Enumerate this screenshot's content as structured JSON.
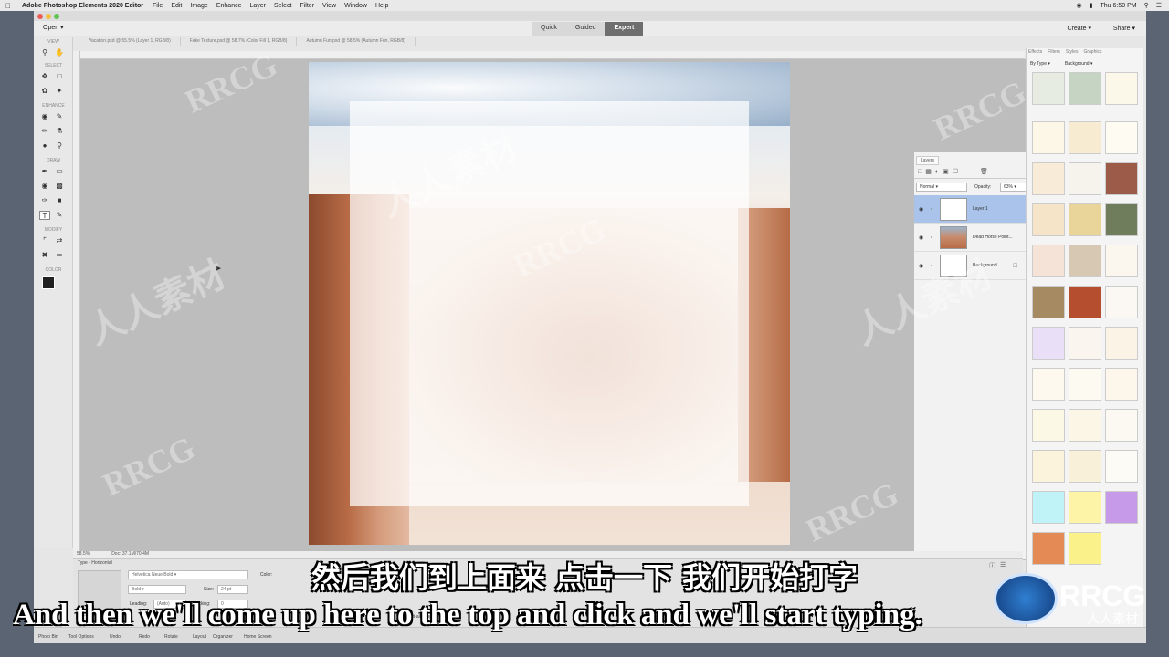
{
  "menubar": {
    "app_name": "Adobe Photoshop Elements 2020 Editor",
    "items": [
      "File",
      "Edit",
      "Image",
      "Enhance",
      "Layer",
      "Select",
      "Filter",
      "View",
      "Window",
      "Help"
    ],
    "time": "Thu 6:50 PM"
  },
  "topbar": {
    "open_label": "Open",
    "modes": [
      "Quick",
      "Guided",
      "Expert"
    ],
    "active_mode": "Expert",
    "create_label": "Create",
    "share_label": "Share"
  },
  "doc_tabs": [
    "Vacation.psd @ 55.5% (Layer 1, RGB/8)",
    "Fake Texture.psd @ 58.7% (Color Fill 1, RGB/8)",
    "Autumn Fun.psd @ 58.5% (Autumn Fun, RGB/8)"
  ],
  "toolbox": {
    "sections": [
      "VIEW",
      "SELECT",
      "ENHANCE",
      "DRAW",
      "MODIFY",
      "COLOR"
    ]
  },
  "layers_panel": {
    "tab_label": "Layers",
    "blend_mode": "Normal",
    "opacity_label": "Opacity:",
    "opacity_value": "63%",
    "layers": [
      {
        "name": "Layer 1",
        "selected": true
      },
      {
        "name": "Dead Horse Point...",
        "selected": false
      },
      {
        "name": "Background",
        "selected": false
      }
    ]
  },
  "effects_panel": {
    "tabs": [
      "Effects",
      "Filters",
      "Styles",
      "Graphics"
    ],
    "filter_by": "By Type",
    "filter_value": "Background"
  },
  "status_bar": {
    "zoom": "58.5%",
    "doc_size": "Doc: 37.1M/70.4M"
  },
  "tool_options": {
    "title": "Type - Horizontal",
    "font_family": "Helvetica Neue Bold",
    "font_style": "Bold",
    "size_label": "Size:",
    "size_value": "24 pt",
    "leading_label": "Leading:",
    "leading_value": "(Auto)",
    "tracking_label": "Tracking:",
    "tracking_value": "0",
    "color_label": "Color:",
    "antialias_label": "Anti-aliasing"
  },
  "taskbar": [
    "Photo Bin",
    "Tool Options",
    "Undo",
    "Redo",
    "Rotate",
    "Layout",
    "Organizer",
    "Home Screen"
  ],
  "subtitles": {
    "chinese": "然后我们到上面来 点击一下 我们开始打字",
    "english": "And then we'll come up here to the top and click and we'll start typing."
  },
  "watermark": {
    "text": "RRCG",
    "cn_text": "人人素材",
    "logo_text": "RRCG",
    "logo_cn": "人人素材"
  },
  "colors": {
    "selected_layer": "#a9c3ea",
    "active_mode_tab": "#6e6e6e"
  }
}
